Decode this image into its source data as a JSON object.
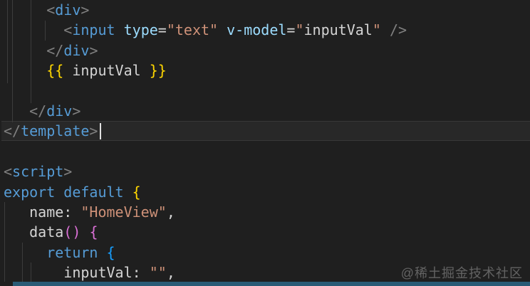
{
  "editor": {
    "watermark_text": "@稀土掘金技术社区",
    "palette": {
      "bg": "#1f1f1f",
      "text": "#d4d4d4",
      "punct": "#808080",
      "tag": "#569cd6",
      "attr": "#9cdcfe",
      "string": "#ce9178",
      "gold": "#ffd700",
      "orchid": "#da70d6",
      "blue3": "#179fff",
      "guide": "#3c3c3c",
      "cursor": "#e0e0e0",
      "bar": "#2a5b76",
      "watermark": "rgba(255,255,255,0.3)"
    },
    "lines": [
      {
        "segments": [
          [
            "     ",
            "text"
          ],
          [
            "<",
            "punct"
          ],
          [
            "div",
            "tag"
          ],
          [
            ">",
            "punct"
          ]
        ]
      },
      {
        "segments": [
          [
            "       ",
            "text"
          ],
          [
            "<",
            "punct"
          ],
          [
            "input",
            "tag"
          ],
          [
            " ",
            "text"
          ],
          [
            "type",
            "attr"
          ],
          [
            "=",
            "text"
          ],
          [
            "\"text\"",
            "string"
          ],
          [
            " ",
            "text"
          ],
          [
            "v-model",
            "attr"
          ],
          [
            "=",
            "text"
          ],
          [
            "\"",
            "string"
          ],
          [
            "inputVal",
            "text"
          ],
          [
            "\"",
            "string"
          ],
          [
            " ",
            "text"
          ],
          [
            "/>",
            "punct"
          ]
        ]
      },
      {
        "segments": [
          [
            "     ",
            "text"
          ],
          [
            "</",
            "punct"
          ],
          [
            "div",
            "tag"
          ],
          [
            ">",
            "punct"
          ]
        ]
      },
      {
        "segments": [
          [
            "     ",
            "text"
          ],
          [
            "{{",
            "gold"
          ],
          [
            " inputVal ",
            "text"
          ],
          [
            "}}",
            "gold"
          ]
        ]
      },
      {
        "segments": []
      },
      {
        "segments": [
          [
            "   ",
            "text"
          ],
          [
            "</",
            "punct"
          ],
          [
            "div",
            "tag"
          ],
          [
            ">",
            "punct"
          ]
        ]
      },
      {
        "segments": [
          [
            "</",
            "punct"
          ],
          [
            "template",
            "tag"
          ],
          [
            ">",
            "punct"
          ]
        ]
      },
      {
        "segments": []
      },
      {
        "segments": [
          [
            "<",
            "punct"
          ],
          [
            "script",
            "tag"
          ],
          [
            ">",
            "punct"
          ]
        ]
      },
      {
        "segments": [
          [
            "export",
            "tag"
          ],
          [
            " ",
            "text"
          ],
          [
            "default",
            "tag"
          ],
          [
            " ",
            "text"
          ],
          [
            "{",
            "gold"
          ]
        ]
      },
      {
        "segments": [
          [
            "   ",
            "text"
          ],
          [
            "name",
            "text"
          ],
          [
            ":",
            "text"
          ],
          [
            " ",
            "text"
          ],
          [
            "\"HomeView\"",
            "string"
          ],
          [
            ",",
            "text"
          ]
        ]
      },
      {
        "segments": [
          [
            "   ",
            "text"
          ],
          [
            "data",
            "text"
          ],
          [
            "()",
            "orchid"
          ],
          [
            " ",
            "text"
          ],
          [
            "{",
            "orchid"
          ]
        ]
      },
      {
        "segments": [
          [
            "     ",
            "text"
          ],
          [
            "return",
            "tag"
          ],
          [
            " ",
            "text"
          ],
          [
            "{",
            "blue3"
          ]
        ]
      },
      {
        "segments": [
          [
            "       ",
            "text"
          ],
          [
            "inputVal",
            "text"
          ],
          [
            ":",
            "text"
          ],
          [
            " ",
            "text"
          ],
          [
            "\"\"",
            "string"
          ],
          [
            ",",
            "text"
          ]
        ]
      }
    ]
  }
}
